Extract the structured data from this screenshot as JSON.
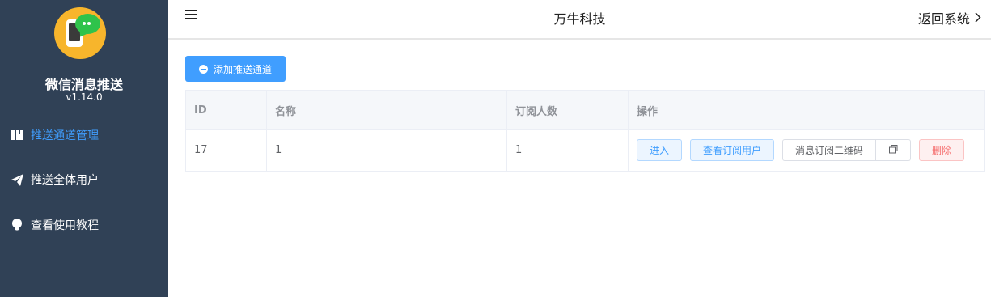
{
  "sidebar": {
    "app_title": "微信消息推送",
    "version": "v1.14.0",
    "items": [
      {
        "label": "推送通道管理",
        "icon": "book-icon",
        "active": true
      },
      {
        "label": "推送全体用户",
        "icon": "paper-plane-icon",
        "active": false
      },
      {
        "label": "查看使用教程",
        "icon": "lightbulb-icon",
        "active": false
      }
    ]
  },
  "header": {
    "title": "万牛科技",
    "back_label": "返回系统"
  },
  "toolbar": {
    "add_label": "添加推送通道"
  },
  "table": {
    "columns": [
      "ID",
      "名称",
      "订阅人数",
      "操作"
    ],
    "rows": [
      {
        "id": "17",
        "name": "1",
        "subscribers": "1"
      }
    ],
    "actions": {
      "enter": "进入",
      "view_users": "查看订阅用户",
      "qr_code": "消息订阅二维码",
      "delete": "删除"
    }
  },
  "colors": {
    "sidebar_bg": "#304156",
    "accent": "#409eff",
    "danger": "#f56c6c"
  }
}
